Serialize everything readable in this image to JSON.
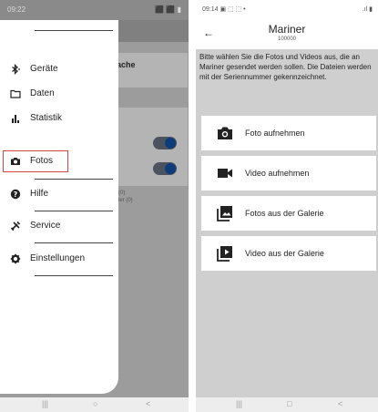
{
  "left_screen": {
    "status_bar": {
      "time": "09:22",
      "icons": "⬛ ⬛ ▮"
    },
    "background": {
      "card_text": "ache",
      "small_text_1": "(0)",
      "small_text_2": "ler (0)"
    },
    "drawer": {
      "items": [
        {
          "label": "Geräte",
          "icon": "bluetooth-icon"
        },
        {
          "label": "Daten",
          "icon": "folder-icon"
        },
        {
          "label": "Statistik",
          "icon": "bar-chart-icon"
        },
        {
          "label": "Fotos",
          "icon": "camera-icon",
          "selected": true
        },
        {
          "label": "Hilfe",
          "icon": "help-icon"
        },
        {
          "label": "Service",
          "icon": "tools-icon"
        },
        {
          "label": "Einstellungen",
          "icon": "gear-icon"
        }
      ]
    },
    "nav": {
      "recent": "|||",
      "home": "○",
      "back": "<"
    }
  },
  "right_screen": {
    "status_bar": {
      "time": "09:14",
      "icons_left": "▣ ⬚ ⬚ •",
      "icons_right": ".ıl ▮"
    },
    "app_bar": {
      "back": "←",
      "title": "Mariner",
      "subtitle": "100000"
    },
    "intro": "Bitte wählen Sie die Fotos und Videos aus, die an Mariner gesendet werden sollen. Die Dateien werden mit der Seriennummer gekennzeichnet.",
    "actions": [
      {
        "label": "Foto aufnehmen",
        "icon": "camera-icon"
      },
      {
        "label": "Video aufnehmen",
        "icon": "video-camera-icon"
      },
      {
        "label": "Fotos aus der Galerie",
        "icon": "photo-library-icon"
      },
      {
        "label": "Video aus der Galerie",
        "icon": "video-library-icon"
      }
    ],
    "nav": {
      "recent": "|||",
      "home": "□",
      "back": "<"
    }
  },
  "colors": {
    "selected_outline": "#d64545",
    "toggle_thumb": "#0d3c78"
  }
}
